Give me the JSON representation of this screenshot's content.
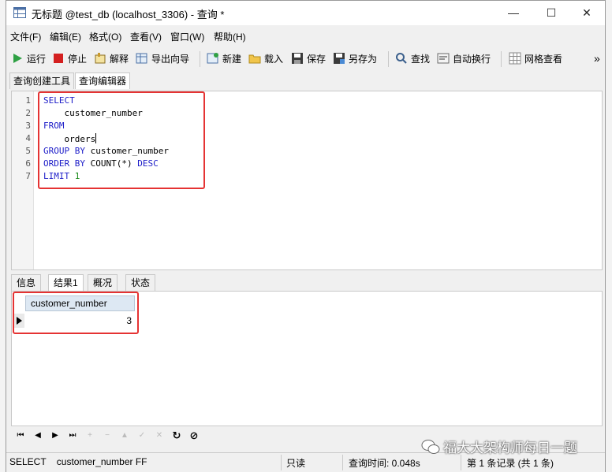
{
  "window": {
    "title": "无标题 @test_db (localhost_3306) - 查询 *",
    "minimize": "—",
    "maximize": "☐",
    "close": "✕"
  },
  "menu": [
    "文件(F)",
    "编辑(E)",
    "格式(O)",
    "查看(V)",
    "窗口(W)",
    "帮助(H)"
  ],
  "toolbar": {
    "run": "运行",
    "stop": "停止",
    "explain": "解释",
    "export_wizard": "导出向导",
    "new": "新建",
    "load": "载入",
    "save": "保存",
    "save_as": "另存为",
    "find": "查找",
    "word_wrap": "自动换行",
    "grid_view": "网格查看",
    "more": "»"
  },
  "tabs": [
    "查询创建工具",
    "查询编辑器"
  ],
  "editor": {
    "line_numbers": [
      "1",
      "2",
      "3",
      "4",
      "5",
      "6",
      "7"
    ],
    "lines": {
      "l1": "SELECT",
      "l2": "    customer_number",
      "l3": "FROM",
      "l4": "    orders",
      "l5_kw1": "GROUP BY",
      "l5_rest": " customer_number",
      "l6_kw1": "ORDER BY",
      "l6_mid": " COUNT(*) ",
      "l6_kw2": "DESC",
      "l7_kw": "LIMIT",
      "l7_num": "1"
    }
  },
  "result_tabs": [
    "信息",
    "结果1",
    "概况",
    "状态"
  ],
  "results": {
    "columns": [
      "customer_number"
    ],
    "rows": [
      [
        "3"
      ]
    ]
  },
  "nav_icons": {
    "first": "⏮",
    "prev": "◀",
    "next": "▶",
    "last": "⏭",
    "add": "+",
    "delete": "−",
    "edit": "▲",
    "apply": "✓",
    "cancel": "✕",
    "refresh": "↻",
    "stop": "⊘"
  },
  "status": {
    "sql": "SELECT    customer_number FF",
    "readonly": "只读",
    "query_time": "查询时间: 0.048s",
    "records": "第 1 条记录 (共 1 条)"
  },
  "watermark": "福大大架构师每日一题",
  "colors": {
    "keyword": "#1c1cc8",
    "number": "#1a8a1a",
    "highlight_box": "#e53333",
    "header_bg": "#dde8f3"
  }
}
